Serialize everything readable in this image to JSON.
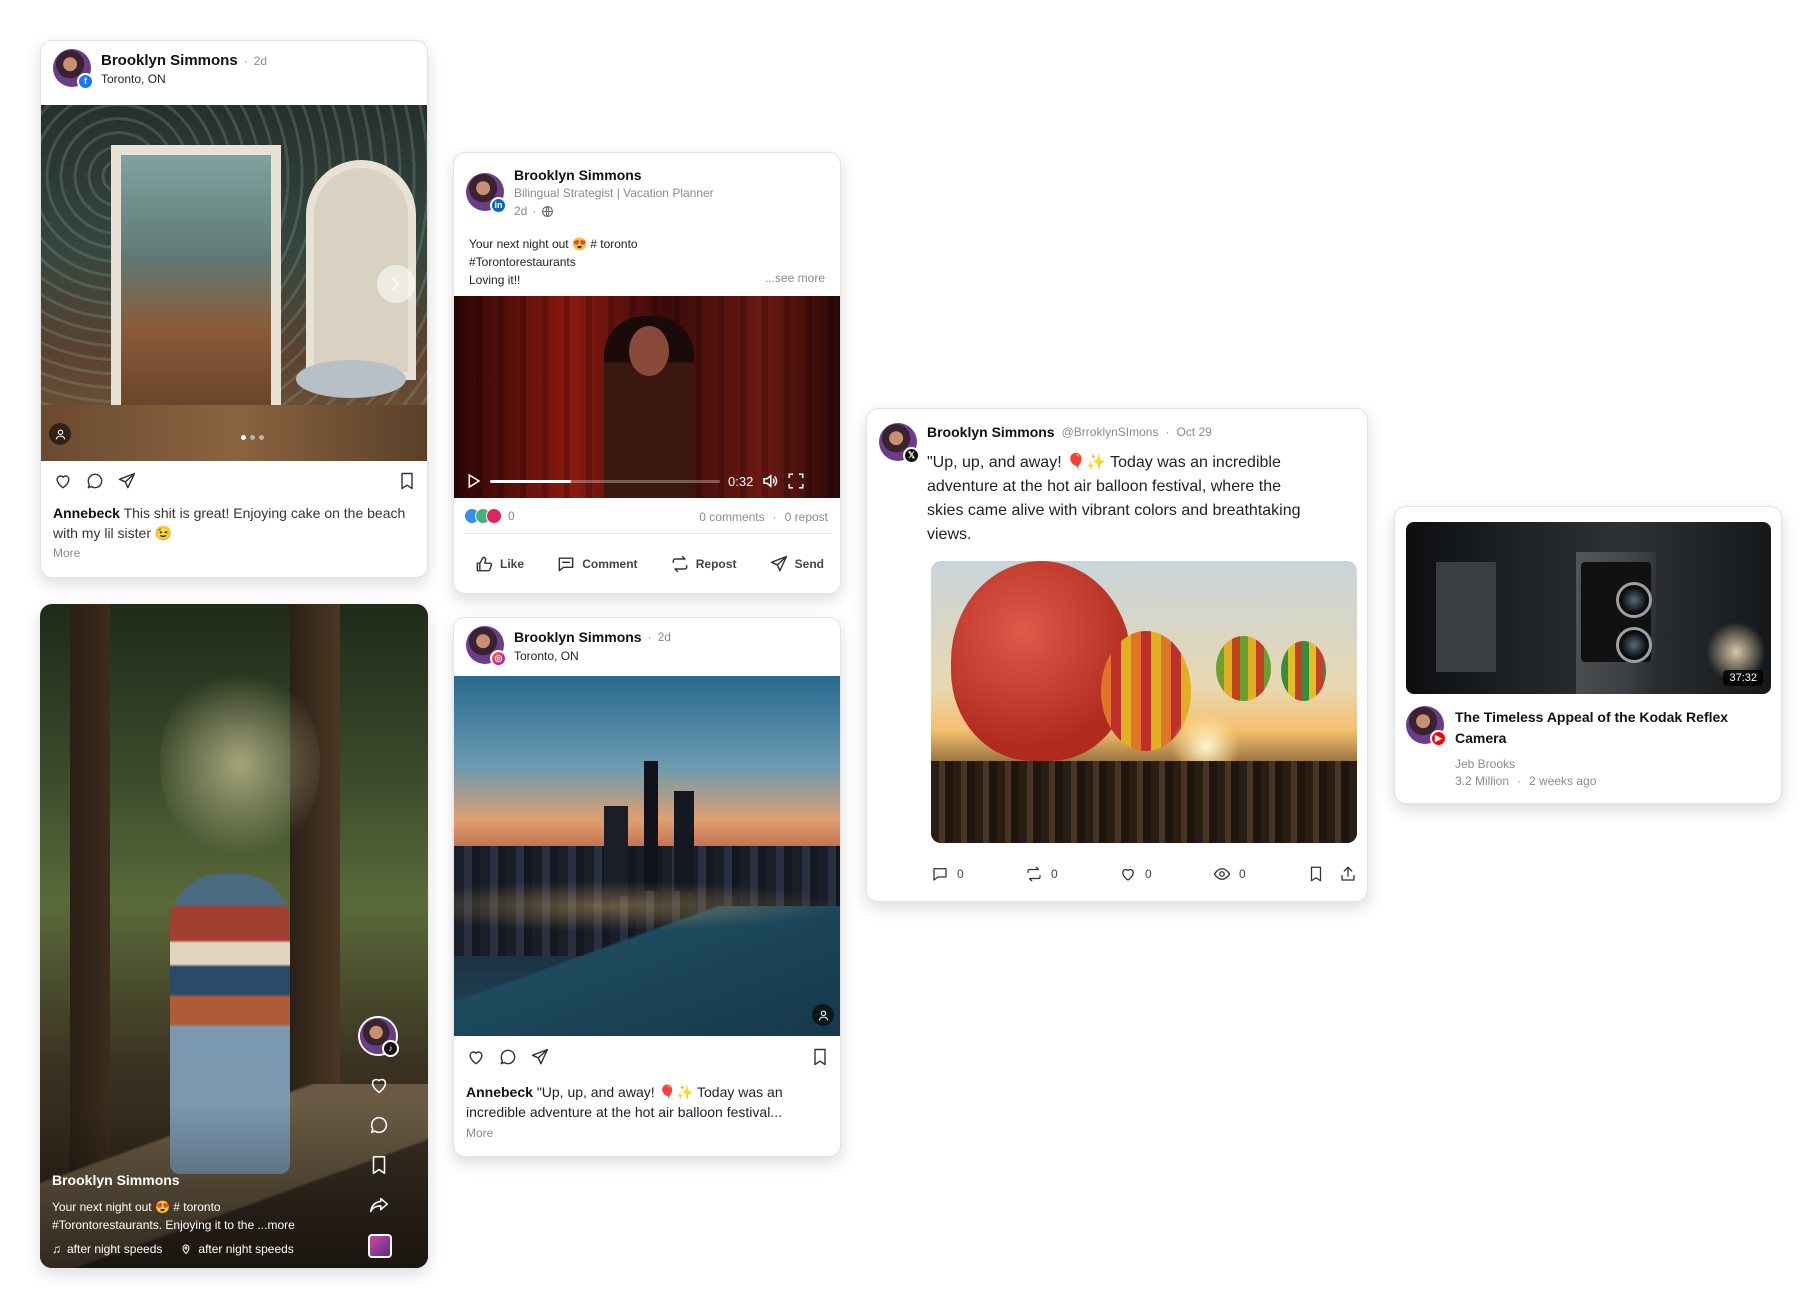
{
  "colors": {
    "facebook": "#1877f2",
    "linkedin": "#0a66c2",
    "instagram": "#e1306c",
    "x": "#111111",
    "tiktok": "#111111",
    "youtube": "#ff0000",
    "like_red": "#e0245e"
  },
  "fb_post": {
    "author": "Brooklyn Simmons",
    "time": "2d",
    "location": "Toronto, ON",
    "platform_icon": "facebook-icon",
    "caption_user": "Annebeck",
    "caption": "This shit is great! Enjoying cake on the beach with my lil sister 😉",
    "more": "More"
  },
  "tiktok_post": {
    "author": "Brooklyn Simmons",
    "platform_icon": "tiktok-icon",
    "caption_line1": "Your next night out 😍 # toronto",
    "caption_line2": "#Torontorestaurants. Enjoying it to the",
    "more": "...more",
    "music": "after night speeds",
    "place": "after night speeds"
  },
  "linkedin_post": {
    "author": "Brooklyn Simmons",
    "headline": "Bilingual Strategist | Vacation Planner",
    "time": "2d",
    "platform_icon": "linkedin-icon",
    "text_line1": "Your next night out 😍 # toronto",
    "text_line2": "#Torontorestaurants",
    "text_line3": "Loving it!!",
    "see_more": "...see more",
    "video_time": "0:32",
    "video_progress": 0.35,
    "reactions_count": "0",
    "comments": "0 comments",
    "reposts": "0 repost",
    "actions": {
      "like": "Like",
      "comment": "Comment",
      "repost": "Repost",
      "send": "Send"
    }
  },
  "instagram_post": {
    "author": "Brooklyn Simmons",
    "time": "2d",
    "location": "Toronto, ON",
    "platform_icon": "instagram-icon",
    "caption_user": "Annebeck",
    "caption_line1": "\"Up, up, and away! 🎈✨ Today was an",
    "caption_line2": "incredible adventure at the hot air balloon festival...",
    "more": "More"
  },
  "x_post": {
    "author": "Brooklyn Simmons",
    "handle": "@BrroklynSImons",
    "date": "Oct 29",
    "platform_icon": "x-icon",
    "text_line1": "\"Up, up, and away! 🎈✨ Today was an incredible",
    "text_line2": "adventure at the hot air balloon festival, where the",
    "text_line3": "skies came alive with vibrant colors and breathtaking",
    "text_line4": "views.",
    "replies": "0",
    "reposts": "0",
    "likes": "0",
    "views": "0"
  },
  "youtube_post": {
    "duration": "37:32",
    "title_line1": "The Timeless Appeal of the Kodak Reflex",
    "title_line2": "Camera",
    "channel": "Jeb Brooks",
    "views": "3.2 Million",
    "age": "2 weeks ago",
    "platform_icon": "youtube-icon"
  }
}
